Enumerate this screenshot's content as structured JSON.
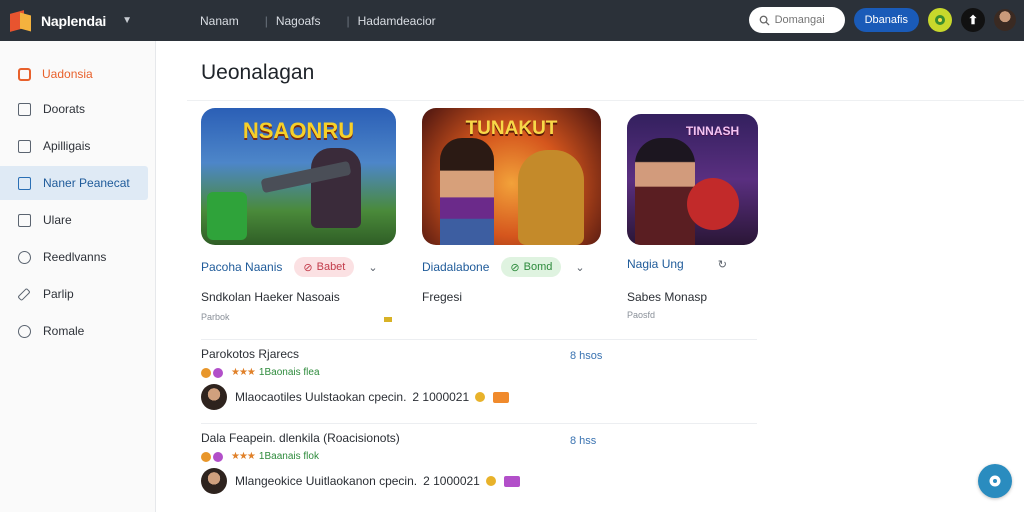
{
  "app": {
    "name": "Naplendai"
  },
  "topnav": {
    "items": [
      "Nanam",
      "Nagoafs",
      "Hadamdeacior"
    ]
  },
  "search": {
    "placeholder": "Domangai"
  },
  "header_button": {
    "label": "Dbanafis"
  },
  "sidebar": {
    "section": "Uadonsia",
    "items": [
      {
        "label": "Doorats",
        "icon": "square-icon"
      },
      {
        "label": "Apilligais",
        "icon": "lock-icon"
      },
      {
        "label": "Naner Peanecat",
        "icon": "calendar-icon",
        "active": true
      },
      {
        "label": "Ulare",
        "icon": "square-icon"
      },
      {
        "label": "Reedlvanns",
        "icon": "refresh-icon"
      },
      {
        "label": "Parlip",
        "icon": "pen-icon"
      },
      {
        "label": "Romale",
        "icon": "chat-icon"
      }
    ]
  },
  "page": {
    "title": "Ueonalagan"
  },
  "cards": [
    {
      "thumb_text": "NSAONRU",
      "name": "Pacoha Naanis",
      "pill": "Babet",
      "subtitle": "Sndkolan Haeker Nasoais",
      "tag": "Parbok"
    },
    {
      "thumb_text": "TUNAKUT",
      "name": "Diadalabone",
      "pill": "Bomd",
      "subtitle": "Fregesi",
      "tag": ""
    },
    {
      "thumb_text": "TINNASH",
      "name": "Nagia Ung",
      "pill": "",
      "subtitle": "Sabes Monasp",
      "tag": "Paosfd"
    }
  ],
  "list": [
    {
      "title": "Parokotos Rjarecs",
      "stars_label": "1Baonais flea",
      "detail": "Mlaocaotiles Uulstaokan cpecin.",
      "count": "2 1000021",
      "time": "8 hsos",
      "badge_color": "#f08a2c"
    },
    {
      "title": "Dala Feapein. dlenkila (Roacisionots)",
      "stars_label": "1Baanais flok",
      "detail": "Mlangeokice Uuitlaokanon cpecin.",
      "count": "2 1000021",
      "time": "8 hss",
      "badge_color": "#b24fc9"
    }
  ],
  "colors": {
    "topbar": "#2b3139",
    "accent": "#e8612c",
    "primary": "#1a5bb8"
  }
}
